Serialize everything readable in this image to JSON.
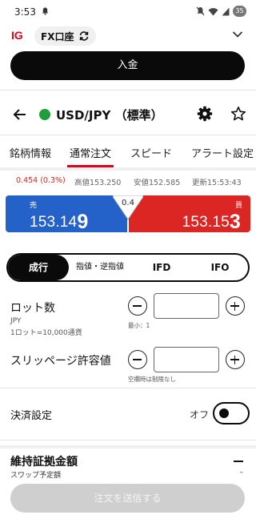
{
  "status_bar": {
    "time": "3:53",
    "battery": "35"
  },
  "header": {
    "logo": "IG",
    "account": "FX口座"
  },
  "deposit_label": "入金",
  "instrument": {
    "symbol": "USD/JPY （標準）",
    "status_color": "#1f9d3a"
  },
  "tabs": [
    "銘柄情報",
    "通常注文",
    "スピード",
    "アラート設定"
  ],
  "active_tab": "通常注文",
  "info": {
    "change": "0.454 (0.3%)",
    "high": "高値153.250",
    "low": "安値152.585",
    "updated": "更新15:53:43"
  },
  "quote": {
    "sell_label": "売",
    "sell_main": "153.14",
    "sell_pip": "9",
    "buy_label": "買",
    "buy_main": "153.15",
    "buy_pip": "3",
    "spread": "0.4",
    "sell_color": "#2462c9",
    "buy_color": "#dc2623"
  },
  "order_types": [
    "成行",
    "指値・逆指値",
    "IFD",
    "IFO"
  ],
  "lot": {
    "label": "ロット数",
    "unit": "JPY",
    "note": "1ロット=10,000通貨",
    "value": "",
    "min_hint": "最小：1"
  },
  "slippage": {
    "label": "スリッページ許容値",
    "value": "",
    "hint": "空欄時は制限なし"
  },
  "settlement": {
    "label": "決済設定",
    "state": "オフ"
  },
  "margin": {
    "label": "維持証拠金額",
    "swap_label": "スワップ予定額",
    "swap_value": "–"
  },
  "submit_label": "注文を送信する"
}
